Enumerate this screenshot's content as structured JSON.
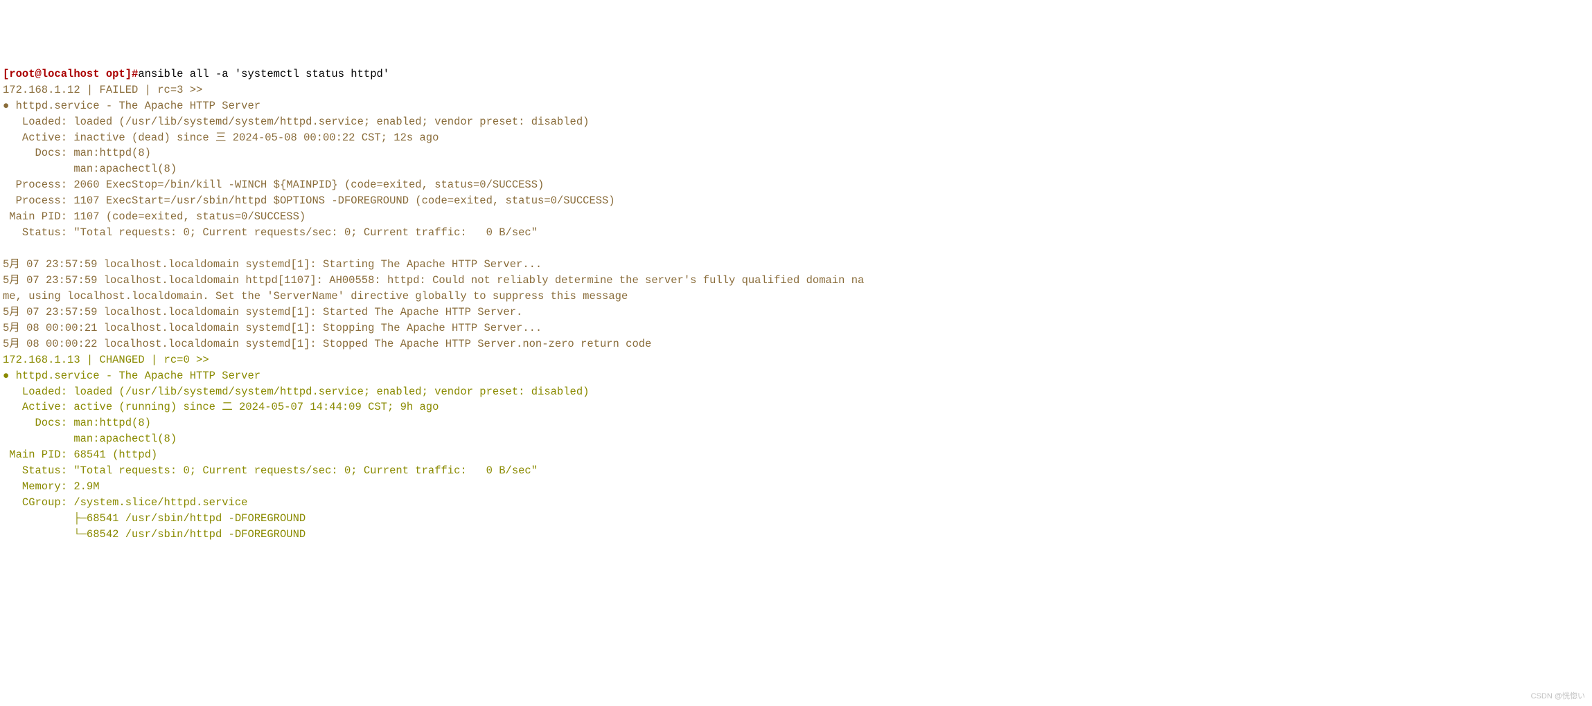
{
  "prompt": "[root@localhost opt]#",
  "command": "ansible all -a 'systemctl status httpd'",
  "host1": {
    "header": "172.168.1.12 | FAILED | rc=3 >>",
    "bullet": "●",
    "svc_line": " httpd.service - The Apache HTTP Server",
    "loaded": "   Loaded: loaded (/usr/lib/systemd/system/httpd.service; enabled; vendor preset: disabled)",
    "active": "   Active: inactive (dead) since 三 2024-05-08 00:00:22 CST; 12s ago",
    "docs1": "     Docs: man:httpd(8)",
    "docs2": "           man:apachectl(8)",
    "proc1": "  Process: 2060 ExecStop=/bin/kill -WINCH ${MAINPID} (code=exited, status=0/SUCCESS)",
    "proc2": "  Process: 1107 ExecStart=/usr/sbin/httpd $OPTIONS -DFOREGROUND (code=exited, status=0/SUCCESS)",
    "mainpid": " Main PID: 1107 (code=exited, status=0/SUCCESS)",
    "status": "   Status: \"Total requests: 0; Current requests/sec: 0; Current traffic:   0 B/sec\"",
    "log1": "5月 07 23:57:59 localhost.localdomain systemd[1]: Starting The Apache HTTP Server...",
    "log2": "5月 07 23:57:59 localhost.localdomain httpd[1107]: AH00558: httpd: Could not reliably determine the server's fully qualified domain na",
    "log3": "me, using localhost.localdomain. Set the 'ServerName' directive globally to suppress this message",
    "log4": "5月 07 23:57:59 localhost.localdomain systemd[1]: Started The Apache HTTP Server.",
    "log5": "5月 08 00:00:21 localhost.localdomain systemd[1]: Stopping The Apache HTTP Server...",
    "log6": "5月 08 00:00:22 localhost.localdomain systemd[1]: Stopped The Apache HTTP Server.non-zero return code"
  },
  "host2": {
    "header": "172.168.1.13 | CHANGED | rc=0 >>",
    "bullet": "●",
    "svc_line": " httpd.service - The Apache HTTP Server",
    "loaded": "   Loaded: loaded (/usr/lib/systemd/system/httpd.service; enabled; vendor preset: disabled)",
    "active": "   Active: active (running) since 二 2024-05-07 14:44:09 CST; 9h ago",
    "docs1": "     Docs: man:httpd(8)",
    "docs2": "           man:apachectl(8)",
    "mainpid": " Main PID: 68541 (httpd)",
    "status": "   Status: \"Total requests: 0; Current requests/sec: 0; Current traffic:   0 B/sec\"",
    "memory": "   Memory: 2.9M",
    "cgroup": "   CGroup: /system.slice/httpd.service",
    "cg1": "           ├─68541 /usr/sbin/httpd -DFOREGROUND",
    "cg2": "           └─68542 /usr/sbin/httpd -DFOREGROUND"
  },
  "watermark": "CSDN @恍惚い"
}
